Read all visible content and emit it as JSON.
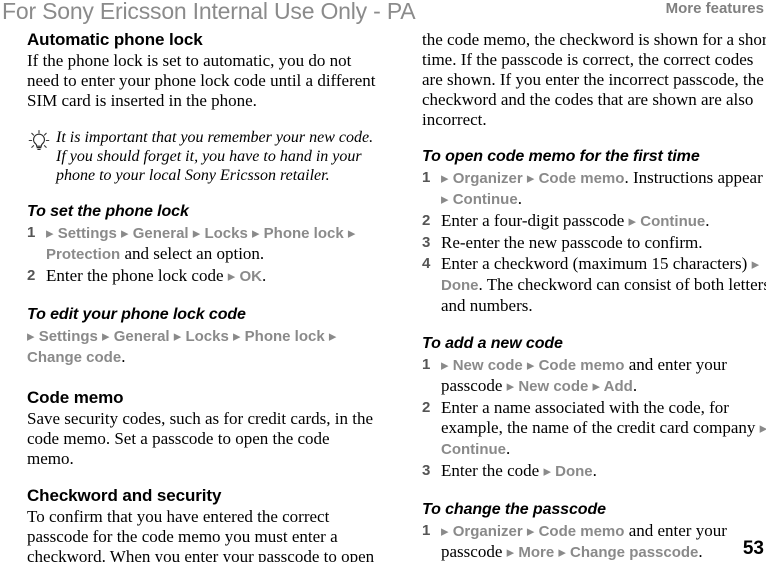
{
  "header": {
    "watermark": "For Sony Ericsson Internal Use Only - PA",
    "running_head": "More features"
  },
  "footer": {
    "page_number": "53"
  },
  "colors": {
    "menu_token": "#8a8a8a",
    "watermark": "#8b8b8b",
    "running_head": "#808080",
    "step_number": "#555555",
    "body_text": "#000000"
  },
  "left_column": {
    "section_1": {
      "heading": "Automatic phone lock",
      "body": "If the phone lock is set to automatic, you do not need to enter your phone lock code until a different SIM card is inserted in the phone."
    },
    "tip": {
      "icon": "lightbulb-icon",
      "text": "It is important that you remember your new code. If you should forget it, you have to hand in your phone to your local Sony Ericsson retailer."
    },
    "procedure_1": {
      "heading": "To set the phone lock",
      "steps": [
        {
          "number": "1",
          "parts": [
            {
              "type": "menu",
              "text": "▸ Settings ▸ General ▸ Locks ▸ Phone lock ▸ Protection"
            },
            {
              "type": "plain",
              "text": " and select an option."
            }
          ]
        },
        {
          "number": "2",
          "parts": [
            {
              "type": "plain",
              "text": "Enter the phone lock code "
            },
            {
              "type": "menu",
              "text": "▸ OK"
            },
            {
              "type": "plain",
              "text": "."
            }
          ]
        }
      ]
    },
    "procedure_2": {
      "heading": "To edit your phone lock code",
      "path_parts": [
        {
          "type": "menu",
          "text": "▸ Settings ▸ General ▸ Locks ▸ Phone lock ▸ Change code"
        },
        {
          "type": "plain",
          "text": "."
        }
      ]
    },
    "section_2": {
      "heading": "Code memo",
      "body": "Save security codes, such as for credit cards, in the code memo. Set a passcode to open the code memo."
    },
    "section_3": {
      "heading": "Checkword and security",
      "body": "To confirm that you have entered the correct passcode for the code memo you must enter a checkword. When you enter your passcode to open"
    }
  },
  "right_column": {
    "continued_body": "the code memo, the checkword is shown for a short time. If the passcode is correct, the correct codes are shown. If you enter the incorrect passcode, the checkword and the codes that are shown are also incorrect.",
    "procedure_1": {
      "heading": "To open code memo for the first time",
      "steps": [
        {
          "number": "1",
          "parts": [
            {
              "type": "menu",
              "text": "▸ Organizer ▸ Code memo"
            },
            {
              "type": "plain",
              "text": ". Instructions appear "
            },
            {
              "type": "menu",
              "text": "▸ Continue"
            },
            {
              "type": "plain",
              "text": "."
            }
          ]
        },
        {
          "number": "2",
          "parts": [
            {
              "type": "plain",
              "text": "Enter a four-digit passcode "
            },
            {
              "type": "menu",
              "text": "▸ Continue"
            },
            {
              "type": "plain",
              "text": "."
            }
          ]
        },
        {
          "number": "3",
          "parts": [
            {
              "type": "plain",
              "text": "Re-enter the new passcode to confirm."
            }
          ]
        },
        {
          "number": "4",
          "parts": [
            {
              "type": "plain",
              "text": "Enter a checkword (maximum 15 characters) "
            },
            {
              "type": "menu",
              "text": "▸ Done"
            },
            {
              "type": "plain",
              "text": ". The checkword can consist of both letters and numbers."
            }
          ]
        }
      ]
    },
    "procedure_2": {
      "heading": "To add a new code",
      "steps": [
        {
          "number": "1",
          "parts": [
            {
              "type": "menu",
              "text": "▸ New code ▸ Code memo"
            },
            {
              "type": "plain",
              "text": " and enter your passcode "
            },
            {
              "type": "menu",
              "text": "▸ New code ▸ Add"
            },
            {
              "type": "plain",
              "text": "."
            }
          ]
        },
        {
          "number": "2",
          "parts": [
            {
              "type": "plain",
              "text": "Enter a name associated with the code, for example, the name of the credit card company "
            },
            {
              "type": "menu",
              "text": "▸ Continue"
            },
            {
              "type": "plain",
              "text": "."
            }
          ]
        },
        {
          "number": "3",
          "parts": [
            {
              "type": "plain",
              "text": "Enter the code "
            },
            {
              "type": "menu",
              "text": "▸ Done"
            },
            {
              "type": "plain",
              "text": "."
            }
          ]
        }
      ]
    },
    "procedure_3": {
      "heading": "To change the passcode",
      "steps": [
        {
          "number": "1",
          "parts": [
            {
              "type": "menu",
              "text": "▸ Organizer ▸ Code memo"
            },
            {
              "type": "plain",
              "text": " and enter your passcode "
            },
            {
              "type": "menu",
              "text": "▸ More ▸ Change passcode"
            },
            {
              "type": "plain",
              "text": "."
            }
          ]
        }
      ]
    }
  }
}
